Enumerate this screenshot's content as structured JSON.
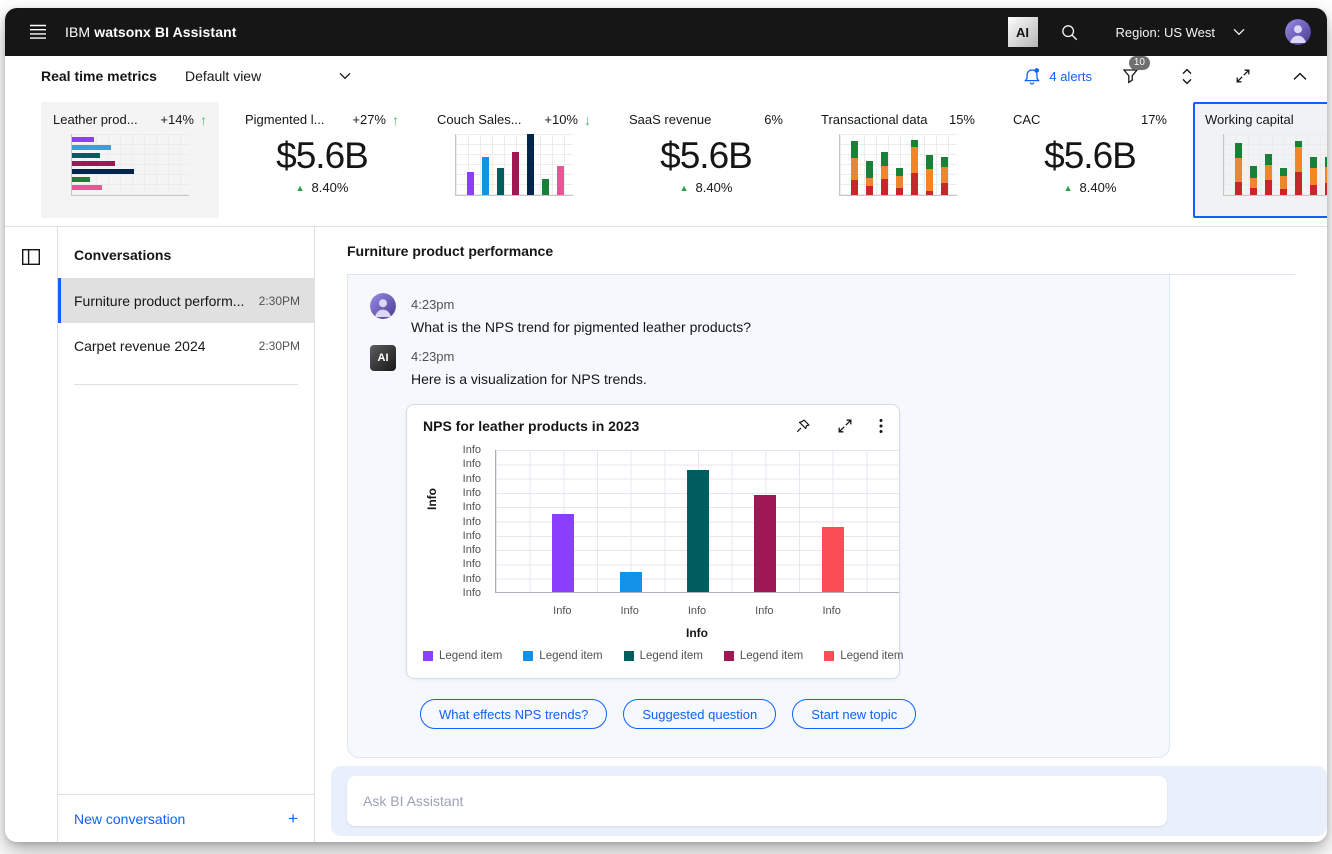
{
  "header": {
    "brand_prefix": "IBM",
    "brand_name": "watsonx BI Assistant",
    "ai_badge": "AI",
    "region_label": "Region: US West"
  },
  "toolbar": {
    "title": "Real time metrics",
    "view_value": "Default view",
    "alerts_label": "4 alerts",
    "filter_badge": "10"
  },
  "metric_cards": [
    {
      "name": "Leather prod...",
      "value": "+14%",
      "trend": "up",
      "style": "muted",
      "type": "hbar",
      "bars": [
        19,
        33,
        24,
        37,
        53,
        15,
        26
      ],
      "colors": [
        "#8a3ffc",
        "#33a1e8",
        "#005d5d",
        "#9f1853",
        "#04264d",
        "#198038",
        "#ee5396"
      ]
    },
    {
      "name": "Pigmented l...",
      "value": "+27%",
      "trend": "up",
      "type": "kpi",
      "kpi": "$5.6B",
      "change": "8.40%"
    },
    {
      "name": "Couch Sales...",
      "value": "+10%",
      "trend": "down",
      "type": "vbar",
      "bars": [
        37,
        62,
        45,
        70,
        100,
        26,
        48
      ],
      "colors": [
        "#8a3ffc",
        "#1192e8",
        "#005d5d",
        "#9f1853",
        "#04264d",
        "#198038",
        "#ee5396"
      ]
    },
    {
      "name": "SaaS revenue",
      "value": "6%",
      "type": "kpi",
      "kpi": "$5.6B",
      "change": "8.40%"
    },
    {
      "name": "Transactional data",
      "value": "15%",
      "type": "stacked",
      "bars": [
        [
          25,
          36,
          28
        ],
        [
          14,
          14,
          27
        ],
        [
          27,
          20,
          23
        ],
        [
          11,
          20,
          13
        ],
        [
          36,
          42,
          12
        ],
        [
          7,
          36,
          22
        ],
        [
          20,
          26,
          17
        ]
      ],
      "stack_colors": [
        "#c9252d",
        "#ed862c",
        "#198038"
      ]
    },
    {
      "name": "CAC",
      "value": "17%",
      "type": "kpi",
      "kpi": "$5.6B",
      "change": "8.40%"
    },
    {
      "name": "Working capital",
      "value": "",
      "type": "stacked",
      "style": "selected",
      "bars": [
        [
          22,
          38,
          25
        ],
        [
          12,
          16,
          20
        ],
        [
          25,
          24,
          18
        ],
        [
          10,
          22,
          12
        ],
        [
          38,
          40,
          10
        ],
        [
          16,
          28,
          18
        ],
        [
          20,
          26,
          16
        ]
      ],
      "stack_colors": [
        "#c9252d",
        "#ed862c",
        "#198038"
      ]
    }
  ],
  "kpi_triangle": "▲",
  "sidebar": {
    "title": "Conversations",
    "items": [
      {
        "label": "Furniture product perform...",
        "time": "2:30PM",
        "selected": true
      },
      {
        "label": "Carpet revenue 2024",
        "time": "2:30PM",
        "selected": false
      }
    ],
    "new_conversation_label": "New conversation",
    "plus_label": "+"
  },
  "chat": {
    "title": "Furniture product performance",
    "ai_badge": "AI",
    "messages": [
      {
        "author": "user",
        "time": "4:23pm",
        "text": "What is the NPS trend for pigmented leather products?"
      },
      {
        "author": "ai",
        "time": "4:23pm",
        "text": "Here is a visualization for NPS trends."
      }
    ],
    "chart_card": {
      "title": "NPS for leather products in 2023",
      "chart_data": {
        "type": "bar",
        "categories": [
          "Info",
          "Info",
          "Info",
          "Info",
          "Info"
        ],
        "values": [
          55,
          14,
          86,
          68,
          46
        ],
        "colors": [
          "#8a3ffc",
          "#1192e8",
          "#005d5d",
          "#9f1853",
          "#fa4d56"
        ],
        "ylabel": "Info",
        "xlabel": "Info",
        "ylim": [
          0,
          100
        ],
        "y_ticks": [
          "Info",
          "Info",
          "Info",
          "Info",
          "Info",
          "Info",
          "Info",
          "Info",
          "Info",
          "Info",
          "Info"
        ],
        "grid": true,
        "legend_position": "bottom",
        "legend": [
          {
            "label": "Legend item",
            "color": "#8a3ffc"
          },
          {
            "label": "Legend item",
            "color": "#1192e8"
          },
          {
            "label": "Legend item",
            "color": "#005d5d"
          },
          {
            "label": "Legend item",
            "color": "#9f1853"
          },
          {
            "label": "Legend item",
            "color": "#fa4d56"
          }
        ]
      }
    },
    "suggestions": [
      "What effects NPS trends?",
      "Suggested question",
      "Start new topic"
    ],
    "input_placeholder": "Ask BI Assistant"
  }
}
